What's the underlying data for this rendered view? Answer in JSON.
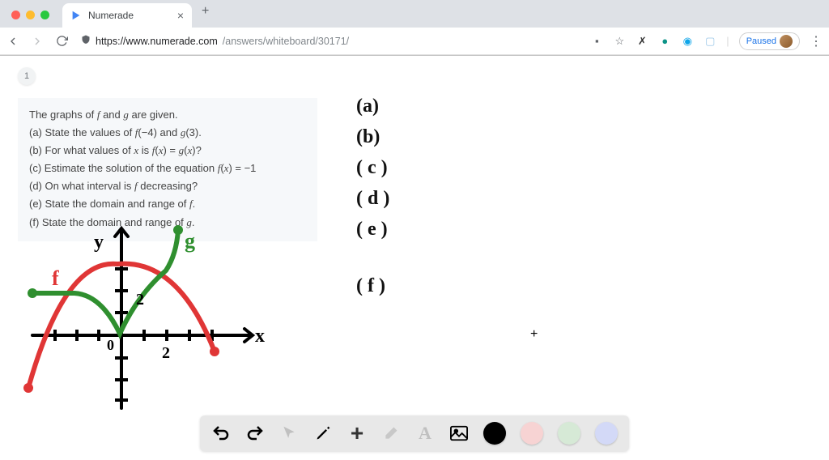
{
  "browser": {
    "tab_title": "Numerade",
    "url_host": "https://www.numerade.com",
    "url_path": "/answers/whiteboard/30171/",
    "paused_label": "Paused"
  },
  "page": {
    "number": "1"
  },
  "problem": {
    "intro": "The graphs of f and g are given.",
    "a": "(a) State the values of f(−4) and g(3).",
    "b": "(b) For what values of x is f(x) = g(x)?",
    "c": "(c) Estimate the solution of the equation f(x) = −1",
    "d": "(d) On what interval is f decreasing?",
    "e": "(e) State the domain and range of f.",
    "f": "(f) State the domain and range of g."
  },
  "handwritten": {
    "a": "(a)",
    "b": "(b)",
    "c": "( c )",
    "d": "( d )",
    "e": "( e )",
    "f": "( f )"
  },
  "graph": {
    "y_label": "y",
    "x_label": "x",
    "f_label": "f",
    "g_label": "g",
    "tick_x": "2",
    "tick_y": "2"
  },
  "toolbar": {
    "undo": "undo",
    "redo": "redo",
    "pointer": "pointer",
    "pen": "pen",
    "plus": "plus",
    "eraser": "eraser",
    "text": "text",
    "image": "image",
    "colors": {
      "black": "#000000",
      "pink": "#f7d3d3",
      "green": "#d6e9d6",
      "blue": "#d3d9f7"
    }
  }
}
